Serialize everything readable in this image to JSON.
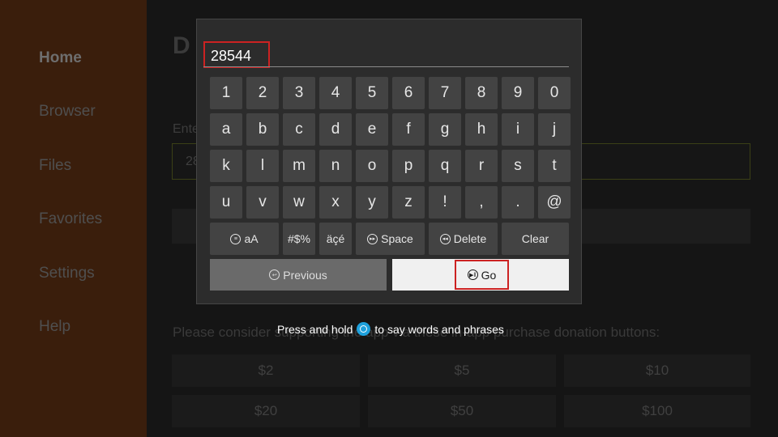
{
  "sidebar": {
    "items": [
      {
        "label": "Home",
        "active": true
      },
      {
        "label": "Browser"
      },
      {
        "label": "Files"
      },
      {
        "label": "Favorites"
      },
      {
        "label": "Settings"
      },
      {
        "label": "Help"
      }
    ]
  },
  "background": {
    "enter_label": "Ente",
    "url_value": "28",
    "donate_text": "Please consider supporting the app via these in-app purchase donation buttons:",
    "donations": [
      "$2",
      "$5",
      "$10",
      "$20",
      "$50",
      "$100"
    ]
  },
  "keyboard": {
    "input_value": "28544",
    "rows": [
      [
        "1",
        "2",
        "3",
        "4",
        "5",
        "6",
        "7",
        "8",
        "9",
        "0"
      ],
      [
        "a",
        "b",
        "c",
        "d",
        "e",
        "f",
        "g",
        "h",
        "i",
        "j"
      ],
      [
        "k",
        "l",
        "m",
        "n",
        "o",
        "p",
        "q",
        "r",
        "s",
        "t"
      ],
      [
        "u",
        "v",
        "w",
        "x",
        "y",
        "z",
        "!",
        ",",
        ".",
        "@"
      ]
    ],
    "func_keys": {
      "case_label": "aA",
      "symbols_label": "#$%",
      "accents_label": "äçé",
      "space_label": "Space",
      "delete_label": "Delete",
      "clear_label": "Clear"
    },
    "previous_label": "Previous",
    "go_label": "Go"
  },
  "hint": {
    "before": "Press and hold",
    "after": "to say words and phrases",
    "icon": "alexa-icon"
  },
  "colors": {
    "sidebar_bg": "#3a1e0c",
    "highlight": "#cc2222",
    "alexa_blue": "#1ea1dd"
  }
}
